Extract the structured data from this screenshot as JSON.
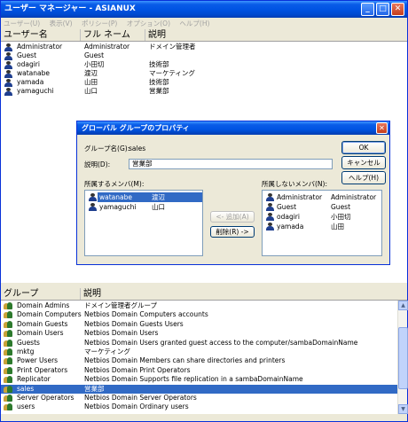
{
  "window": {
    "title": "ユーザー マネージャー - ASIANUX"
  },
  "menu": [
    "ユーザー(U)",
    "表示(V)",
    "ポリシー(P)",
    "オプション(O)",
    "ヘルプ(H)"
  ],
  "users": {
    "headers": {
      "name": "ユーザー名",
      "fullname": "フル ネーム",
      "desc": "説明"
    },
    "rows": [
      {
        "name": "Administrator",
        "fullname": "Administrator",
        "desc": "ドメイン管理者"
      },
      {
        "name": "Guest",
        "fullname": "Guest",
        "desc": ""
      },
      {
        "name": "odagiri",
        "fullname": "小田切",
        "desc": "技術部"
      },
      {
        "name": "watanabe",
        "fullname": "渡辺",
        "desc": "マーケティング"
      },
      {
        "name": "yamada",
        "fullname": "山田",
        "desc": "技術部"
      },
      {
        "name": "yamaguchi",
        "fullname": "山口",
        "desc": "営業部"
      }
    ]
  },
  "groups": {
    "headers": {
      "group": "グループ",
      "desc": "説明"
    },
    "rows": [
      {
        "name": "Domain Admins",
        "desc": "ドメイン管理者グループ"
      },
      {
        "name": "Domain Computers",
        "desc": "Netbios Domain Computers accounts"
      },
      {
        "name": "Domain Guests",
        "desc": "Netbios Domain Guests Users"
      },
      {
        "name": "Domain Users",
        "desc": "Netbios Domain Users"
      },
      {
        "name": "Guests",
        "desc": "Netbios Domain Users granted guest access to the computer/sambaDomainName"
      },
      {
        "name": "mktg",
        "desc": "マーケティング"
      },
      {
        "name": "Power Users",
        "desc": "Netbios Domain Members can share directories and printers"
      },
      {
        "name": "Print Operators",
        "desc": "Netbios Domain Print Operators"
      },
      {
        "name": "Replicator",
        "desc": "Netbios Domain Supports file replication in a sambaDomainName"
      },
      {
        "name": "sales",
        "desc": "営業部"
      },
      {
        "name": "Server Operators",
        "desc": "Netbios Domain Server Operators"
      },
      {
        "name": "users",
        "desc": "Netbios Domain Ordinary users"
      }
    ],
    "selected_index": 9
  },
  "dialog": {
    "title": "グローバル グループのプロパティ",
    "group_name_label": "グループ名(G):",
    "group_name": "sales",
    "desc_label": "説明(D):",
    "desc_value": "営業部",
    "members_label": "所属するメンバ(M):",
    "nonmembers_label": "所属しないメンバ(N):",
    "members": [
      {
        "name": "watanabe",
        "fullname": "渡辺"
      },
      {
        "name": "yamaguchi",
        "fullname": "山口"
      }
    ],
    "nonmembers": [
      {
        "name": "Administrator",
        "fullname": "Administrator"
      },
      {
        "name": "Guest",
        "fullname": "Guest"
      },
      {
        "name": "odagiri",
        "fullname": "小田切"
      },
      {
        "name": "yamada",
        "fullname": "山田"
      }
    ],
    "buttons": {
      "ok": "OK",
      "cancel": "キャンセル",
      "help": "ヘルプ(H)",
      "add": "<- 追加(A)",
      "remove": "削除(R) ->"
    }
  },
  "colors": {
    "selection": "#316ac5",
    "titlebar": "#0054e3",
    "chrome": "#ece9d8"
  }
}
